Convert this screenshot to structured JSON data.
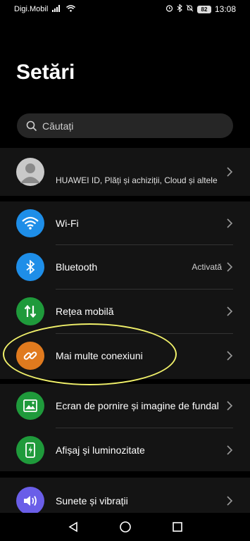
{
  "status_bar": {
    "carrier": "Digi.Mobil",
    "battery": "82",
    "time": "13:08"
  },
  "page_title": "Setări",
  "search": {
    "placeholder": "Căutați"
  },
  "profile": {
    "name": "",
    "subtitle": "HUAWEI ID, Plăți și achiziții, Cloud și altele"
  },
  "rows": {
    "wifi": {
      "label": "Wi-Fi",
      "icon": "wifi-icon",
      "color": "#1e8ee8"
    },
    "bluetooth": {
      "label": "Bluetooth",
      "value": "Activată",
      "icon": "bluetooth-icon",
      "color": "#1e8ee8"
    },
    "mobile": {
      "label": "Rețea mobilă",
      "icon": "mobile-data-icon",
      "color": "#1f9a3b"
    },
    "more": {
      "label": "Mai multe conexiuni",
      "icon": "link-icon",
      "color": "#e07a1e"
    },
    "wallpaper": {
      "label": "Ecran de pornire și imagine de fundal",
      "icon": "image-icon",
      "color": "#1f9a3b"
    },
    "display": {
      "label": "Afișaj și luminozitate",
      "icon": "phone-brightness-icon",
      "color": "#1f9a3b"
    },
    "sounds": {
      "label": "Sunete și vibrații",
      "icon": "speaker-icon",
      "color": "#6a5ee8"
    }
  },
  "colors": {
    "highlight": "#f0f06a",
    "group_bg": "#141414"
  }
}
